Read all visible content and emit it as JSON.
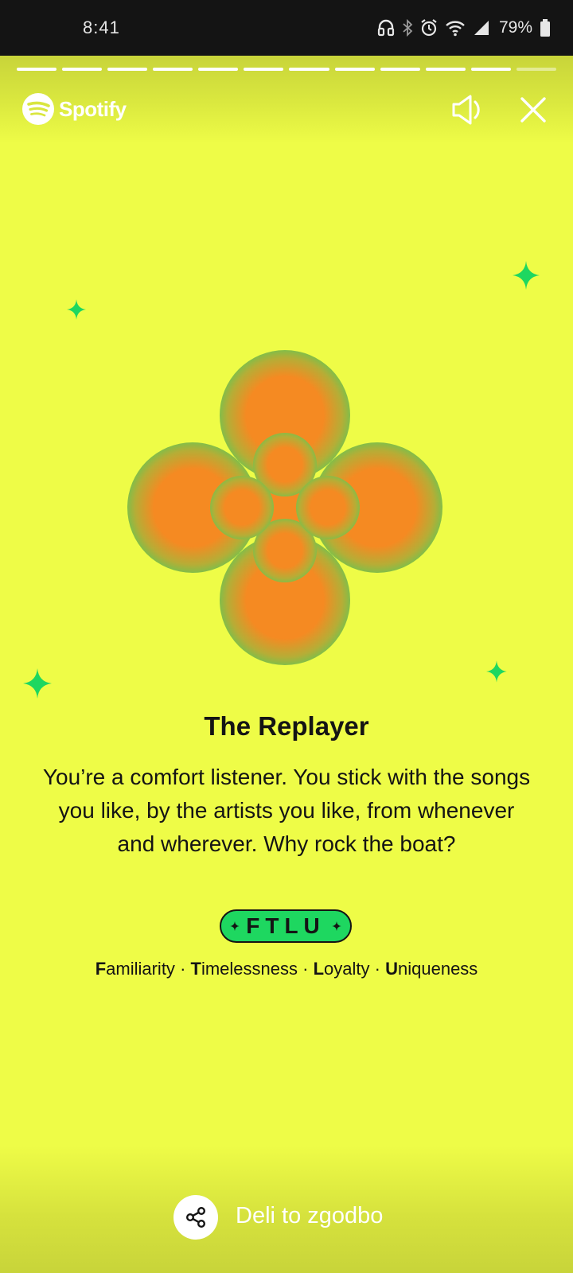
{
  "status_bar": {
    "time": "8:41",
    "battery_percent": "79%",
    "icons": [
      "headset-icon",
      "bluetooth-icon",
      "alarm-icon",
      "wifi-icon",
      "signal-icon",
      "battery-icon"
    ]
  },
  "story": {
    "progress_segments_total": 12,
    "progress_segments_completed": 11
  },
  "header": {
    "brand_name": "Spotify",
    "mute_icon": "speaker-muted-icon",
    "close_icon": "close-icon"
  },
  "card": {
    "title": "The Replayer",
    "description": "You’re a comfort listener. You stick with the songs you like, by the artists you like, from whenever and wherever. Why rock the boat?",
    "badge": "FTLU",
    "traits": [
      {
        "initial": "F",
        "rest": "amiliarity"
      },
      {
        "initial": "T",
        "rest": "imelessness"
      },
      {
        "initial": "L",
        "rest": "oyalty"
      },
      {
        "initial": "U",
        "rest": "niqueness"
      }
    ],
    "separator": "·"
  },
  "footer": {
    "share_label": "Deli to zgodbo",
    "share_icon": "share-icon"
  },
  "colors": {
    "background": "#eefc47",
    "accent_green": "#1ed760",
    "accent_orange": "#f58a22",
    "text": "#141414"
  }
}
